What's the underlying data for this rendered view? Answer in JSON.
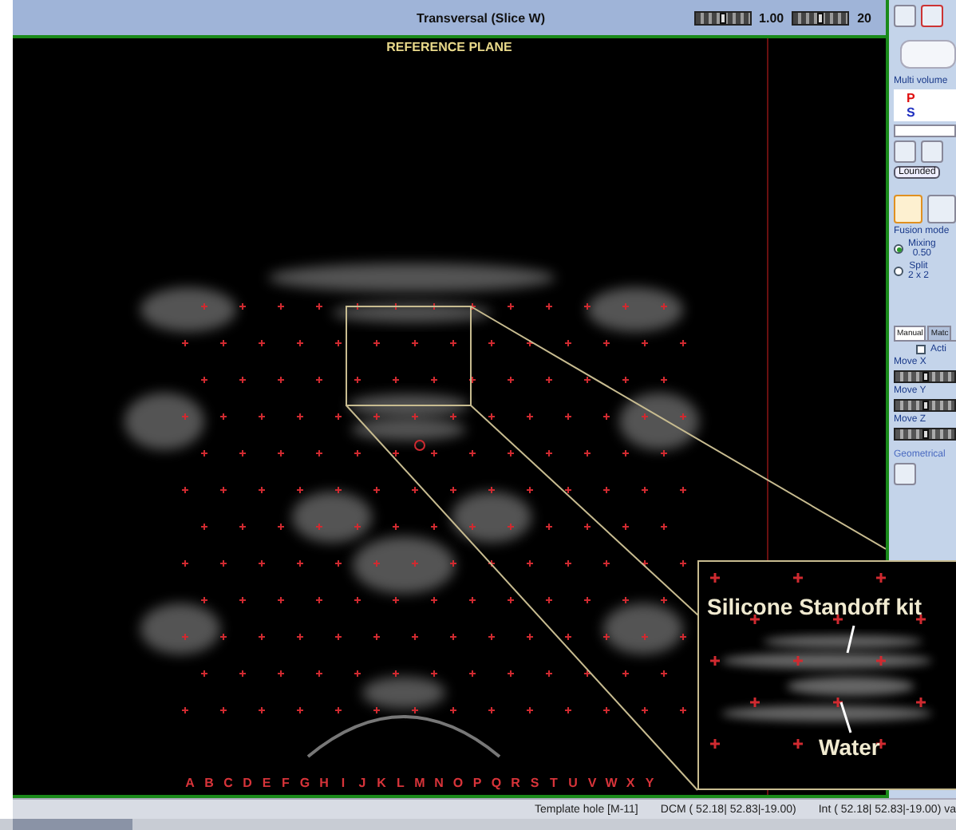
{
  "title_bar": {
    "title": "Transversal (Slice W)",
    "zoom_slider": {
      "level": 0.5
    },
    "zoom_value": "1.00",
    "slice_slider": {
      "level": 0.5
    },
    "slice_count": "20"
  },
  "viewer": {
    "overlay_label": "REFERENCE PLANE",
    "column_letters": [
      "A",
      "B",
      "C",
      "D",
      "E",
      "F",
      "G",
      "H",
      "I",
      "J",
      "K",
      "L",
      "M",
      "N",
      "O",
      "P",
      "Q",
      "R",
      "S",
      "T",
      "U",
      "V",
      "W",
      "X",
      "Y"
    ],
    "inset": {
      "labels": [
        "Silicone Standoff kit",
        "Water"
      ]
    }
  },
  "side_panel": {
    "multi_volume_label": "Multi volume",
    "volumes": [
      {
        "letter": "P",
        "color": "#e01010"
      },
      {
        "letter": "S",
        "color": "#2030c0"
      }
    ],
    "linked_button": "Lounded",
    "fusion_mode_label": "Fusion mode",
    "fusion_modes": [
      {
        "label": "Mixing",
        "value": "0.50",
        "selected": true
      },
      {
        "label": "Split",
        "value": "2 x 2",
        "selected": false
      }
    ],
    "tabs": [
      {
        "label": "Manual",
        "selected": true
      },
      {
        "label": "Matc",
        "selected": false
      }
    ],
    "active_checkbox": {
      "label": "Acti",
      "checked": false
    },
    "moves": [
      {
        "label": "Move X",
        "level": 0.5
      },
      {
        "label": "Move Y",
        "level": 0.5
      },
      {
        "label": "Move Z",
        "level": 0.5
      }
    ],
    "geometrical_label": "Geometrical"
  },
  "status_bar": {
    "template_hole": "Template hole [M-11]",
    "dcm": "DCM ( 52.18| 52.83|-19.00)",
    "int": "Int ( 52.18| 52.83|-19.00) va"
  }
}
